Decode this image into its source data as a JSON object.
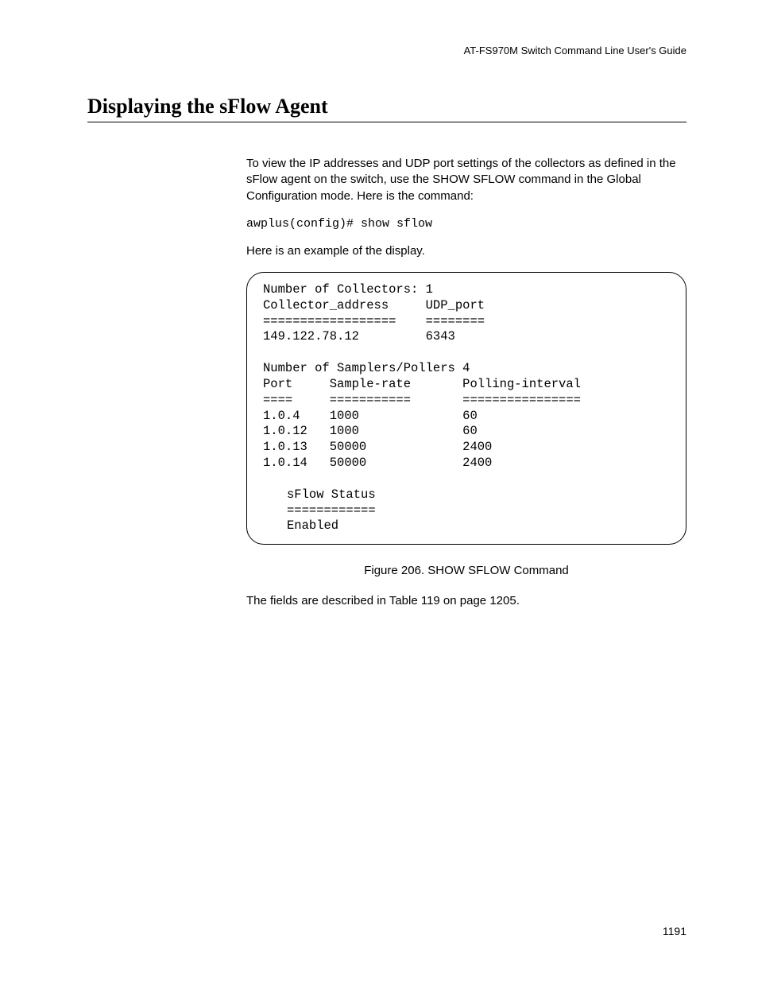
{
  "header": {
    "doc_title": "AT-FS970M Switch Command Line User's Guide"
  },
  "section": {
    "title": "Displaying the sFlow Agent"
  },
  "body": {
    "intro": "To view the IP addresses and UDP port settings of the collectors as defined in the sFlow agent on the switch, use the SHOW SFLOW command in the Global Configuration mode. Here is the command:",
    "command": "awplus(config)# show sflow",
    "example_lead": "Here is an example of the display."
  },
  "terminal": {
    "collectors_header": "Number of Collectors: 1",
    "col_headers": "Collector_address     UDP_port",
    "col_divider": "==================    ========",
    "col_row": "149.122.78.12         6343",
    "samplers_header": "Number of Samplers/Pollers 4",
    "sp_headers": "Port     Sample-rate       Polling-interval",
    "sp_divider": "====     ===========       ================",
    "sp_row1": "1.0.4    1000              60",
    "sp_row2": "1.0.12   1000              60",
    "sp_row3": "1.0.13   50000             2400",
    "sp_row4": "1.0.14   50000             2400",
    "status_title": "sFlow Status",
    "status_div": "============",
    "status_value": "Enabled"
  },
  "figure": {
    "caption": "Figure 206. SHOW SFLOW Command"
  },
  "closing": {
    "text": "The fields are described in Table 119 on page 1205."
  },
  "page_number": "1191"
}
